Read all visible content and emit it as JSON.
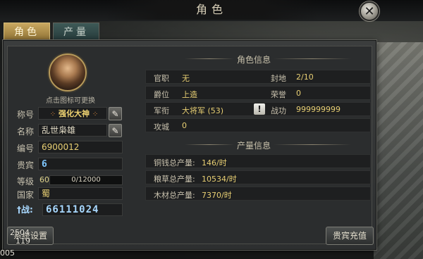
{
  "window": {
    "title": "角色",
    "close_icon": "close-icon"
  },
  "tabs": [
    {
      "label": "角色",
      "active": true
    },
    {
      "label": "产量",
      "active": false
    }
  ],
  "avatar": {
    "hint": "点击图标可更换"
  },
  "profile": {
    "title_label": "称号",
    "title_value": "强化大神",
    "name_label": "名称",
    "name_value": "乱世枭雄",
    "id_label": "编号",
    "id_value": "6900012",
    "vip_label": "贵宾",
    "vip_value": "6",
    "level_label": "等级",
    "level_value": "60",
    "level_progress": "0/12000",
    "nation_label": "国家",
    "nation_value": "蜀",
    "power_label": "战:",
    "power_value": "66111024"
  },
  "role_info": {
    "heading": "角色信息",
    "rows": [
      {
        "k1": "官职",
        "v1": "无",
        "k2": "封地",
        "v2": "2/10"
      },
      {
        "k1": "爵位",
        "v1": "上造",
        "k2": "荣誉",
        "v2": "0"
      },
      {
        "k1": "军衔",
        "v1": "大将军 (53)",
        "k2": "战功",
        "v2": "999999999"
      },
      {
        "k1": "攻城",
        "v1": "0",
        "k2": "",
        "v2": ""
      }
    ]
  },
  "production_info": {
    "heading": "产量信息",
    "rows": [
      {
        "k": "铜钱总产量:",
        "v": "146/时"
      },
      {
        "k": "粮草总产量:",
        "v": "10534/时"
      },
      {
        "k": "木材总产量:",
        "v": "7370/时"
      }
    ]
  },
  "buttons": {
    "settings": "系统设置",
    "vip_recharge": "贵宾充值"
  },
  "overlay": {
    "coord_line1": "2504",
    "coord_line2": "119",
    "coord_line3": "005"
  },
  "colors": {
    "accent_gold": "#c9a860",
    "value_yellow": "#e8cf73",
    "power_blue": "#a8d8ff"
  }
}
